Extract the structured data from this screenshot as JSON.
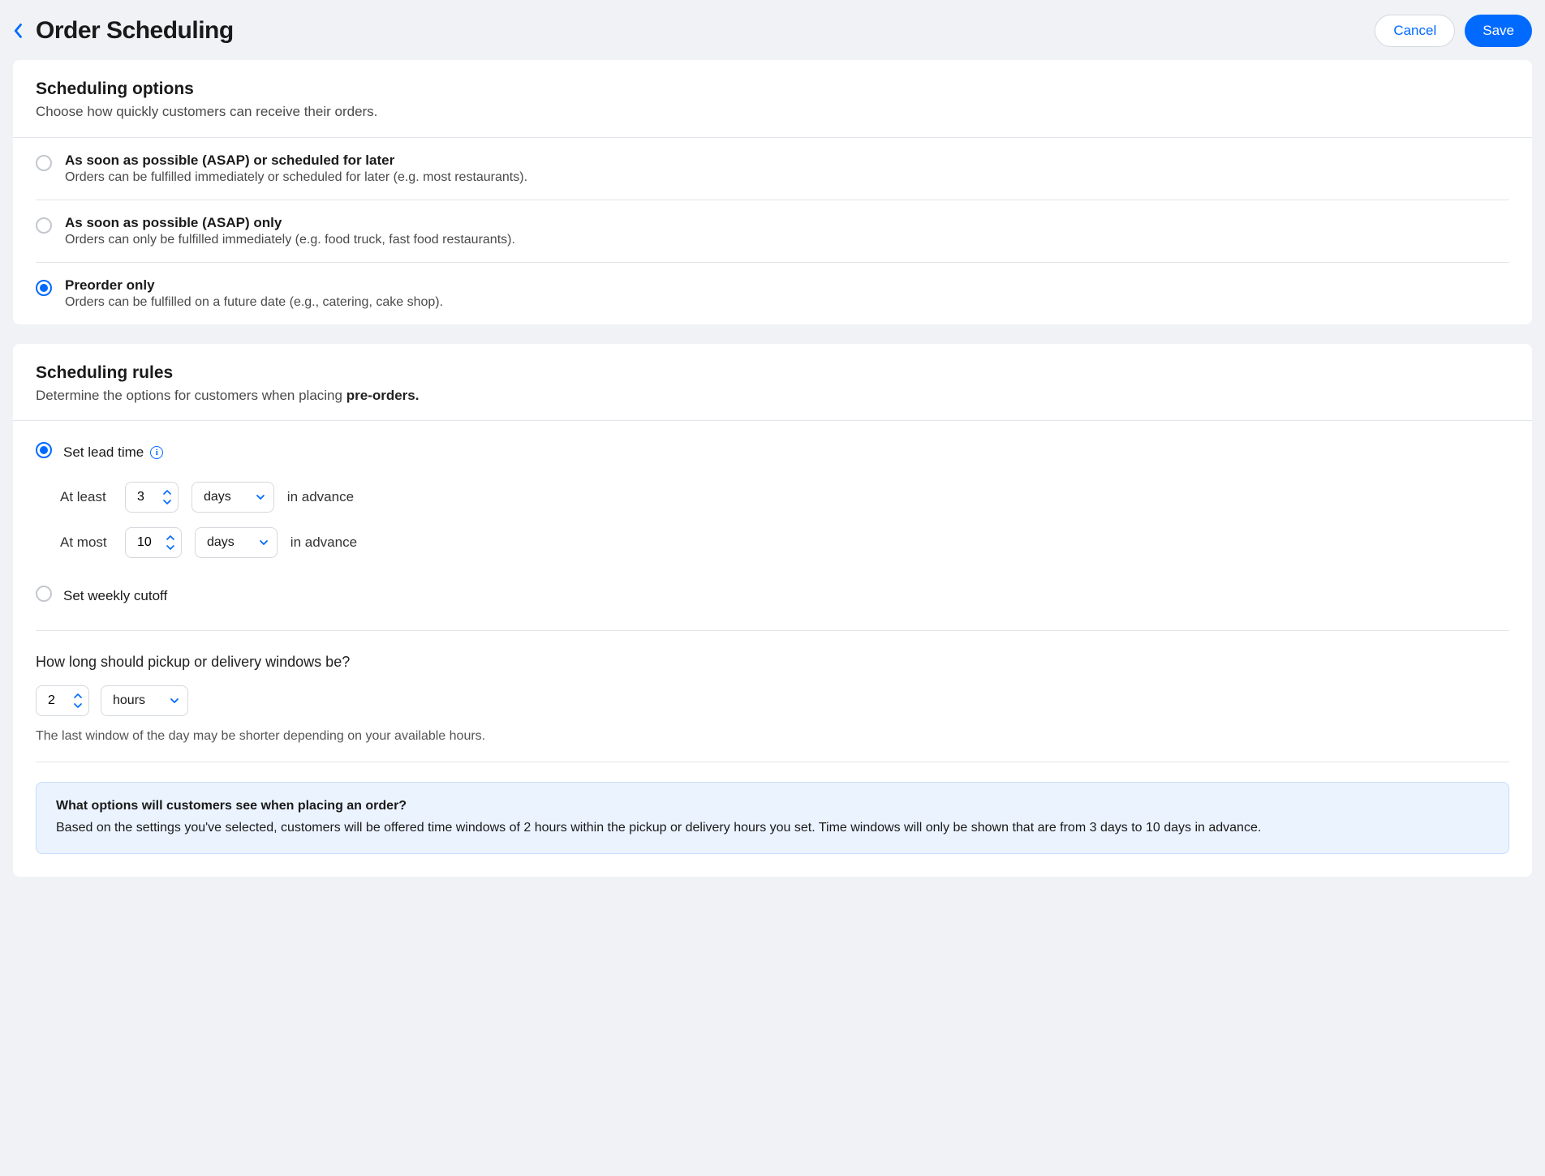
{
  "header": {
    "title": "Order Scheduling",
    "cancel_label": "Cancel",
    "save_label": "Save"
  },
  "scheduling_options": {
    "title": "Scheduling options",
    "subtitle": "Choose how quickly customers can receive their orders.",
    "items": [
      {
        "title": "As soon as possible (ASAP) or scheduled for later",
        "desc": "Orders can be fulfilled immediately or scheduled for later (e.g. most restaurants).",
        "checked": false
      },
      {
        "title": "As soon as possible (ASAP) only",
        "desc": "Orders can only be fulfilled immediately (e.g. food truck, fast food restaurants).",
        "checked": false
      },
      {
        "title": "Preorder only",
        "desc": "Orders can be fulfilled on a future date (e.g., catering, cake shop).",
        "checked": true
      }
    ]
  },
  "scheduling_rules": {
    "title": "Scheduling rules",
    "subtitle_pre": "Determine the options for customers when placing ",
    "subtitle_bold": "pre-orders.",
    "lead_time": {
      "label": "Set lead time",
      "checked": true,
      "at_least_label": "At least",
      "at_least_value": "3",
      "at_least_unit": "days",
      "at_most_label": "At most",
      "at_most_value": "10",
      "at_most_unit": "days",
      "trailing": "in advance"
    },
    "weekly_cutoff": {
      "label": "Set weekly cutoff",
      "checked": false
    },
    "windows": {
      "title": "How long should pickup or delivery windows be?",
      "value": "2",
      "unit": "hours",
      "hint": "The last window of the day may be shorter depending on your available hours."
    },
    "notice": {
      "title": "What options will customers see when placing an order?",
      "body": "Based on the settings you've selected, customers will be offered time windows of 2 hours within the pickup or delivery hours you set. Time windows will only be shown that are from 3 days to 10 days in advance."
    }
  }
}
